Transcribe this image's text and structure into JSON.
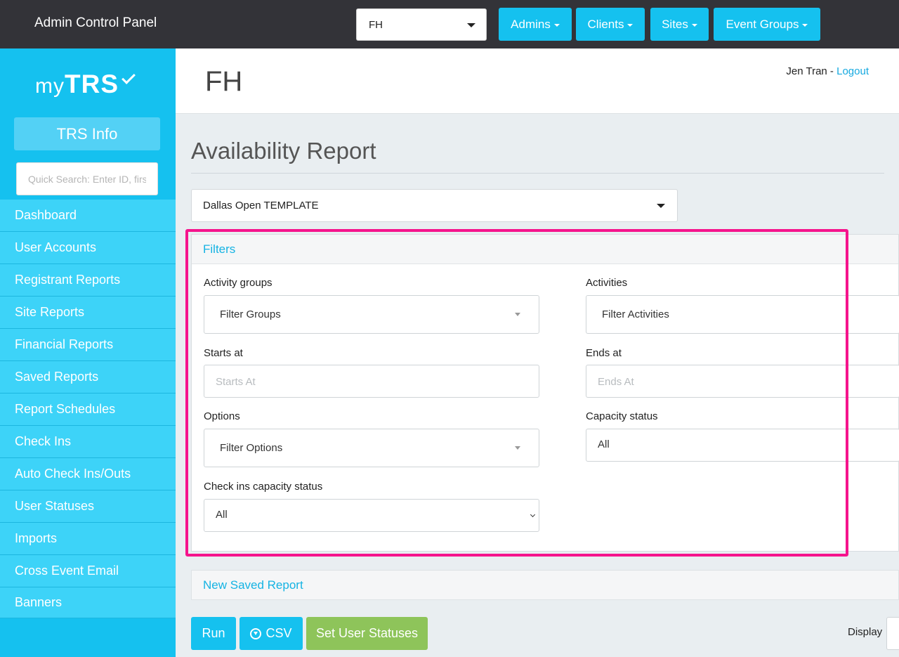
{
  "topbar": {
    "title": "Admin Control Panel",
    "client_select": "FH",
    "nav": [
      {
        "label": "Admins"
      },
      {
        "label": "Clients"
      },
      {
        "label": "Sites"
      },
      {
        "label": "Event Groups"
      }
    ]
  },
  "sidebar": {
    "logo_prefix": "my",
    "logo_main": "TRS",
    "info_button": "TRS Info",
    "search_placeholder": "Quick Search: Enter ID, first",
    "items": [
      {
        "label": "Dashboard"
      },
      {
        "label": "User Accounts"
      },
      {
        "label": "Registrant Reports"
      },
      {
        "label": "Site Reports"
      },
      {
        "label": "Financial Reports"
      },
      {
        "label": "Saved Reports"
      },
      {
        "label": "Report Schedules"
      },
      {
        "label": "Check Ins"
      },
      {
        "label": "Auto Check Ins/Outs"
      },
      {
        "label": "User Statuses"
      },
      {
        "label": "Imports"
      },
      {
        "label": "Cross Event Email"
      },
      {
        "label": "Banners"
      }
    ]
  },
  "header": {
    "title": "FH",
    "user_name": "Jen Tran",
    "separator": " - ",
    "logout": "Logout"
  },
  "report": {
    "title": "Availability Report",
    "event_select": "Dallas Open TEMPLATE"
  },
  "filters": {
    "heading": "Filters",
    "activity_groups_label": "Activity groups",
    "activity_groups_value": "Filter Groups",
    "activities_label": "Activities",
    "activities_value": "Filter Activities",
    "starts_at_label": "Starts at",
    "starts_at_placeholder": "Starts At",
    "ends_at_label": "Ends at",
    "ends_at_placeholder": "Ends At",
    "options_label": "Options",
    "options_value": "Filter Options",
    "capacity_status_label": "Capacity status",
    "capacity_status_value": "All",
    "checkins_capacity_label": "Check ins capacity status",
    "checkins_capacity_value": "All"
  },
  "saved_report": {
    "heading": "New Saved Report"
  },
  "actions": {
    "run": "Run",
    "csv": "CSV",
    "set_user_statuses": "Set User Statuses",
    "display_label": "Display"
  },
  "colors": {
    "accent": "#15c1ef",
    "topbar": "#333338",
    "highlight": "#f5148c",
    "green": "#8ec45a"
  }
}
